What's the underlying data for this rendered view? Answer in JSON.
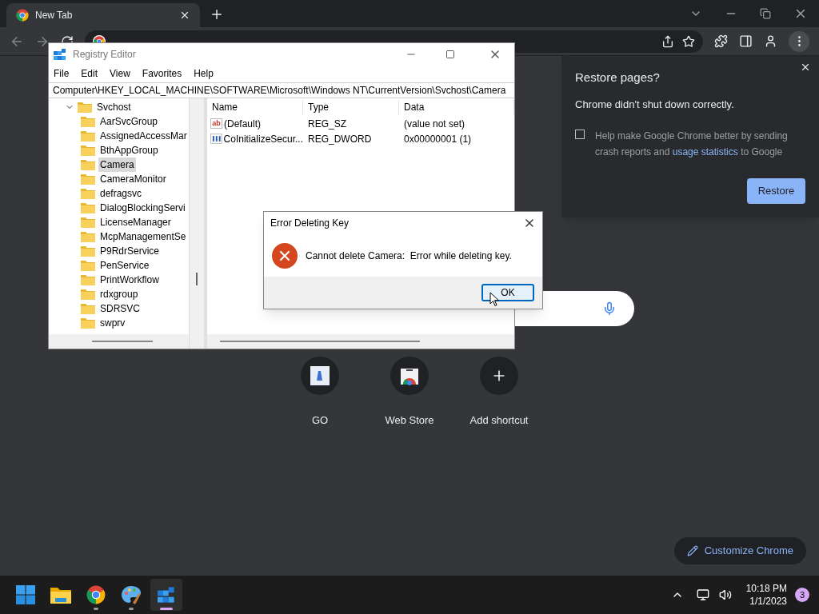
{
  "browser": {
    "tabs": [
      {
        "title": "New Tab",
        "selected": true
      }
    ]
  },
  "registry_editor": {
    "title": "Registry Editor",
    "menu": [
      "File",
      "Edit",
      "View",
      "Favorites",
      "Help"
    ],
    "address": "Computer\\HKEY_LOCAL_MACHINE\\SOFTWARE\\Microsoft\\Windows NT\\CurrentVersion\\Svchost\\Camera",
    "tree": [
      {
        "label": "Svchost",
        "expanded": true,
        "selected": false,
        "children": [
          {
            "label": "AarSvcGroup",
            "selected": false
          },
          {
            "label": "AssignedAccessMar",
            "selected": false
          },
          {
            "label": "BthAppGroup",
            "selected": false
          },
          {
            "label": "Camera",
            "selected": true
          },
          {
            "label": "CameraMonitor",
            "selected": false
          },
          {
            "label": "defragsvc",
            "selected": false
          },
          {
            "label": "DialogBlockingServi",
            "selected": false
          },
          {
            "label": "LicenseManager",
            "selected": false
          },
          {
            "label": "McpManagementSe",
            "selected": false
          },
          {
            "label": "P9RdrService",
            "selected": false
          },
          {
            "label": "PenService",
            "selected": false
          },
          {
            "label": "PrintWorkflow",
            "selected": false
          },
          {
            "label": "rdxgroup",
            "selected": false
          },
          {
            "label": "SDRSVC",
            "selected": false
          },
          {
            "label": "swprv",
            "selected": false
          }
        ]
      }
    ],
    "columns": [
      "Name",
      "Type",
      "Data"
    ],
    "rows": [
      {
        "kind": "string",
        "icon_text": "ab",
        "name": "(Default)",
        "type": "REG_SZ",
        "data": "(value not set)"
      },
      {
        "kind": "binary",
        "name": "CoInitializeSecur...",
        "type": "REG_DWORD",
        "data": "0x00000001 (1)"
      }
    ]
  },
  "error_dialog": {
    "title": "Error Deleting Key",
    "message": "Cannot delete Camera:  Error while deleting key.",
    "button": "OK"
  },
  "restore_popup": {
    "title": "Restore pages?",
    "subtitle": "Chrome didn't shut down correctly.",
    "checkbox": {
      "checked": false,
      "text_before": "Help make Google Chrome better by sending crash reports and",
      "link": "usage statistics",
      "text_after": "to Google"
    },
    "button": "Restore"
  },
  "shortcuts": [
    {
      "kind": "site",
      "label": "GO"
    },
    {
      "kind": "store",
      "label": "Web Store"
    },
    {
      "kind": "add",
      "label": "Add shortcut"
    }
  ],
  "customize_button": "Customize Chrome",
  "taskbar": {
    "apps": [
      {
        "kind": "start",
        "running": false,
        "selected": false
      },
      {
        "kind": "explorer",
        "running": false,
        "selected": false
      },
      {
        "kind": "chrome",
        "running": true,
        "selected": false
      },
      {
        "kind": "paint",
        "running": true,
        "selected": false
      },
      {
        "kind": "regedit",
        "running": true,
        "selected": true
      }
    ],
    "time": "10:18 PM",
    "date": "1/1/2023",
    "badge": "3"
  }
}
